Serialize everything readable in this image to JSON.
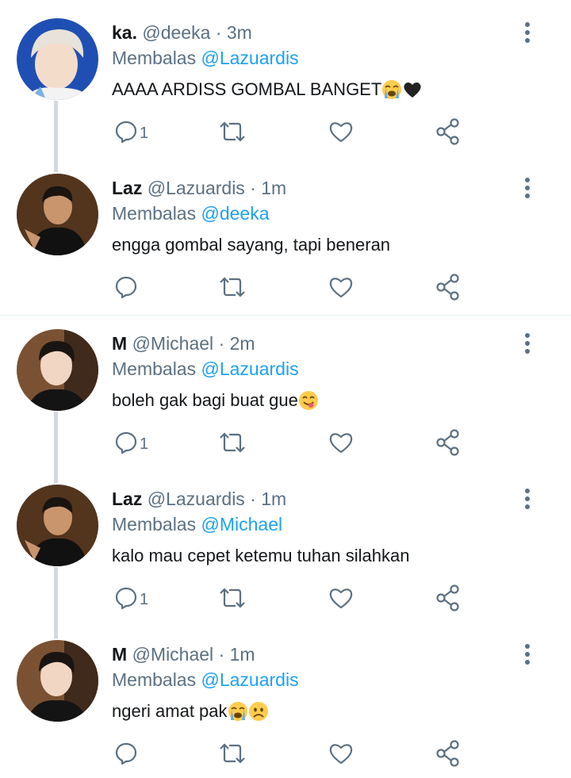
{
  "reply_prefix": "Membalas",
  "colors": {
    "text": "#14171a",
    "secondary": "#5b7083",
    "link": "#1da1f2",
    "thread_line": "#d3d9de",
    "divider": "#e6ecf0"
  },
  "tweets": [
    {
      "name": "ka.",
      "handle": "@deeka",
      "separator": "·",
      "time": "3m",
      "reply_to": "@Lazuardis",
      "text": "AAAA ARDISS GOMBAL BANGET",
      "emojis": [
        "loudly-crying-face",
        "black-heart"
      ],
      "reply_count": "1"
    },
    {
      "name": "Laz",
      "handle": "@Lazuardis",
      "separator": "·",
      "time": "1m",
      "reply_to": "@deeka",
      "text": "engga gombal sayang, tapi beneran",
      "emojis": [],
      "reply_count": ""
    },
    {
      "name": "M",
      "handle": "@Michael",
      "separator": "·",
      "time": "2m",
      "reply_to": "@Lazuardis",
      "text": "boleh gak bagi buat gue",
      "emojis": [
        "face-savoring-food"
      ],
      "reply_count": "1"
    },
    {
      "name": "Laz",
      "handle": "@Lazuardis",
      "separator": "·",
      "time": "1m",
      "reply_to": "@Michael",
      "text": "kalo mau cepet ketemu tuhan silahkan",
      "emojis": [],
      "reply_count": "1"
    },
    {
      "name": "M",
      "handle": "@Michael",
      "separator": "·",
      "time": "1m",
      "reply_to": "@Lazuardis",
      "text": "ngeri amat pak",
      "emojis": [
        "loudly-crying-face",
        "frowning-face"
      ],
      "reply_count": ""
    }
  ]
}
